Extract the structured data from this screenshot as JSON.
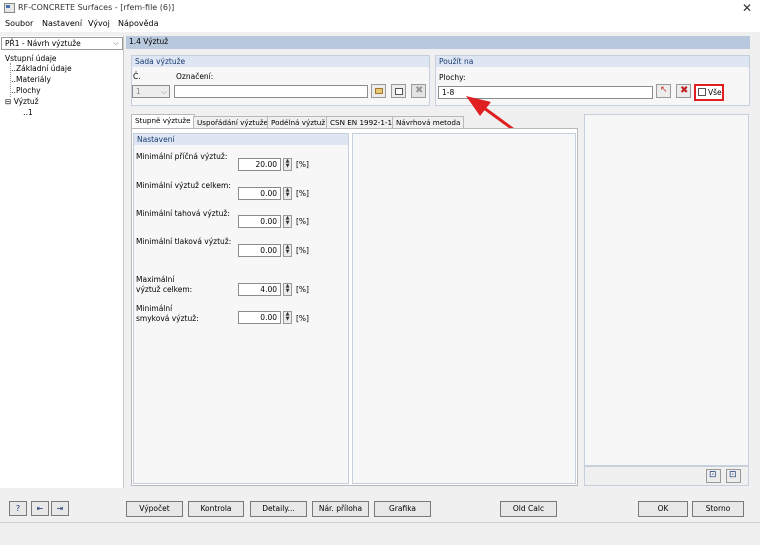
{
  "window": {
    "title": "RF-CONCRETE Surfaces - [rfem-file (6)]",
    "close_glyph": "✕"
  },
  "menu": [
    "Soubor",
    "Nastavení",
    "Vývoj",
    "Nápověda"
  ],
  "case_select": {
    "value": "PŘ1 - Návrh výztuže"
  },
  "tree": {
    "root": "Vstupní údaje",
    "items": [
      "Základní údaje",
      "Materiály",
      "Plochy"
    ],
    "expanded": "Výztuž",
    "child": "1"
  },
  "header": {
    "title": "1.4 Výztuž"
  },
  "sada": {
    "title": "Sada výztuže",
    "cislo_label": "Č.",
    "cislo_value": "1",
    "oznaceni_label": "Označení:",
    "oznaceni_value": ""
  },
  "pouzit": {
    "title": "Použít na",
    "plochy_label": "Plochy:",
    "plochy_value": "1-8",
    "vse_label": "Vše",
    "vse_checked": false
  },
  "tabs": [
    "Stupně výztuže",
    "Uspořádání výztuže",
    "Podélná výztuž",
    "CSN EN 1992-1-1",
    "Návrhová metoda"
  ],
  "settings": {
    "title": "Nastavení",
    "fields": [
      {
        "label": "Minimální příčná výztuž:",
        "value": "20.00",
        "unit": "[%]"
      },
      {
        "label": "Minimální výztuž celkem:",
        "value": "0.00",
        "unit": "[%]"
      },
      {
        "label": "Minimální tahová výztuž:",
        "value": "0.00",
        "unit": "[%]"
      },
      {
        "label": "Minimální tlaková výztuž:",
        "value": "0.00",
        "unit": "[%]"
      },
      {
        "label1": "Maximální",
        "label2": "výztuž celkem:",
        "value": "4.00",
        "unit": "[%]"
      },
      {
        "label1": "Minimální",
        "label2": "smyková výztuž:",
        "value": "0.00",
        "unit": "[%]"
      }
    ]
  },
  "buttons": {
    "vypocet": "Výpočet",
    "kontrola": "Kontrola",
    "detaily": "Detaily...",
    "priloha": "Nár. příloha",
    "grafika": "Grafika",
    "oldcalc": "Old Calc",
    "ok": "OK",
    "storno": "Storno"
  },
  "colors": {
    "accent_red": "#e02020",
    "header_blue": "#b9c9dd"
  }
}
